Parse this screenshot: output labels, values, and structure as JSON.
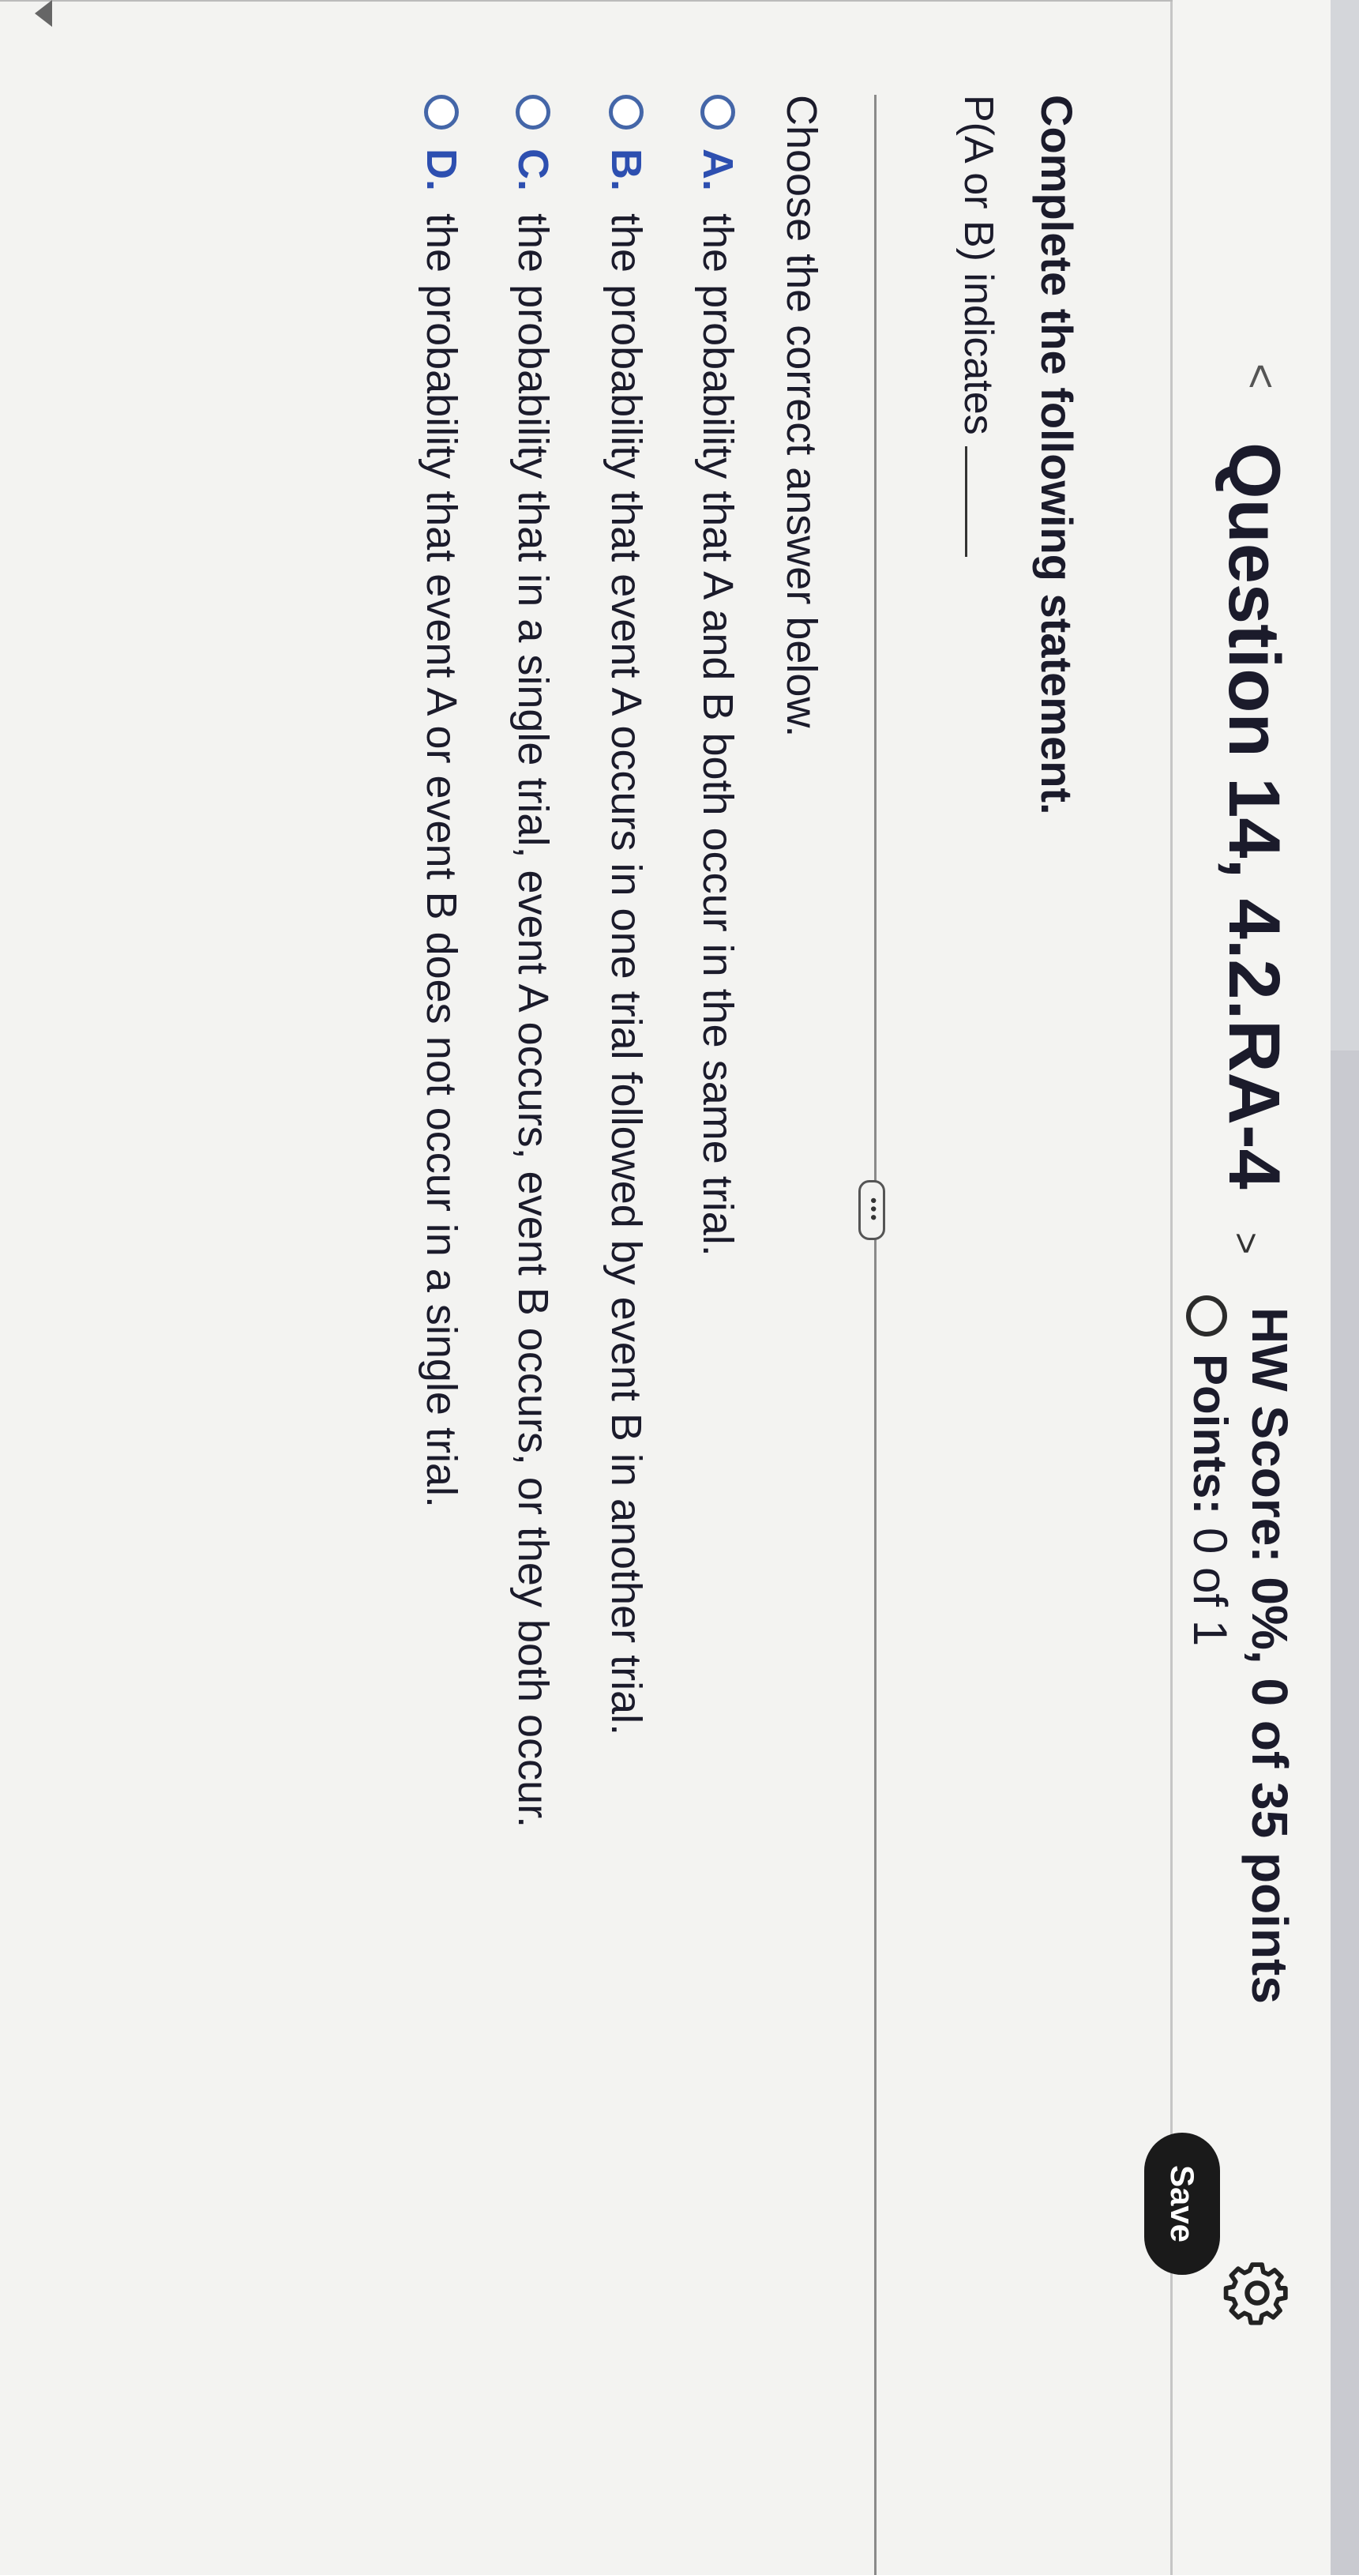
{
  "header": {
    "question_title": "Question 14, 4.2.RA-4",
    "hw_score": "HW Score: 0%, 0 of 35 points",
    "points_label": "Points:",
    "points_value": "0 of 1",
    "save_label": "Save",
    "prev_glyph": "<",
    "next_glyph": ">"
  },
  "question": {
    "instruction": "Complete the following statement.",
    "statement": "P(A or B) indicates",
    "more_button": "•••",
    "choose_prompt": "Choose the correct answer below.",
    "options": [
      {
        "letter": "A.",
        "text": "the probability that A and B both occur in the same trial."
      },
      {
        "letter": "B.",
        "text": "the probability that event A occurs in one trial followed by event B in another trial."
      },
      {
        "letter": "C.",
        "text": "the probability that in a single trial, event A occurs, event B occurs, or they both occur."
      },
      {
        "letter": "D.",
        "text": "the probability that event A or event B does not occur in a single trial."
      }
    ]
  },
  "icons": {
    "settings": "gear-icon",
    "radio": "radio-circle-icon"
  },
  "colors": {
    "save_bg": "#1a1a1a",
    "option_letter": "#2d4fb0",
    "radio_border": "#4466a8"
  }
}
